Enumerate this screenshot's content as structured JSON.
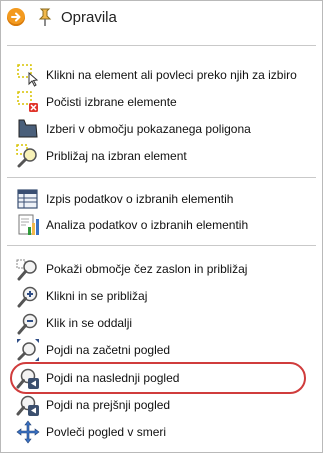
{
  "header": {
    "title": "Opravila"
  },
  "sections": [
    {
      "items": [
        {
          "label": "Klikni na element ali povleci preko njih za izbiro",
          "icon": "select-click-icon"
        },
        {
          "label": "Počisti izbrane elemente",
          "icon": "clear-selection-icon"
        },
        {
          "label": "Izberi v območju pokazanega poligona",
          "icon": "polygon-select-icon"
        },
        {
          "label": "Približaj na izbran element",
          "icon": "zoom-to-selected-icon"
        }
      ]
    },
    {
      "items": [
        {
          "label": "Izpis podatkov o izbranih elementih",
          "icon": "table-icon"
        },
        {
          "label": "Analiza podatkov o izbranih elementih",
          "icon": "analysis-chart-icon"
        }
      ]
    },
    {
      "items": [
        {
          "label": "Pokaži območje čez zaslon in približaj",
          "icon": "zoom-area-icon"
        },
        {
          "label": "Klikni in se približaj",
          "icon": "zoom-in-icon"
        },
        {
          "label": "Klik in se oddalji",
          "icon": "zoom-out-icon"
        },
        {
          "label": "Pojdi na začetni pogled",
          "icon": "full-extent-icon"
        },
        {
          "label": "Pojdi na naslednji pogled",
          "icon": "next-view-icon"
        },
        {
          "label": "Pojdi na prejšnji pogled",
          "icon": "previous-view-icon"
        },
        {
          "label": "Povleči pogled v smeri",
          "icon": "pan-icon"
        }
      ]
    }
  ],
  "colors": {
    "accent": "#f39a1f",
    "highlight": "#d03c3c",
    "separator": "#c9c9c9"
  }
}
